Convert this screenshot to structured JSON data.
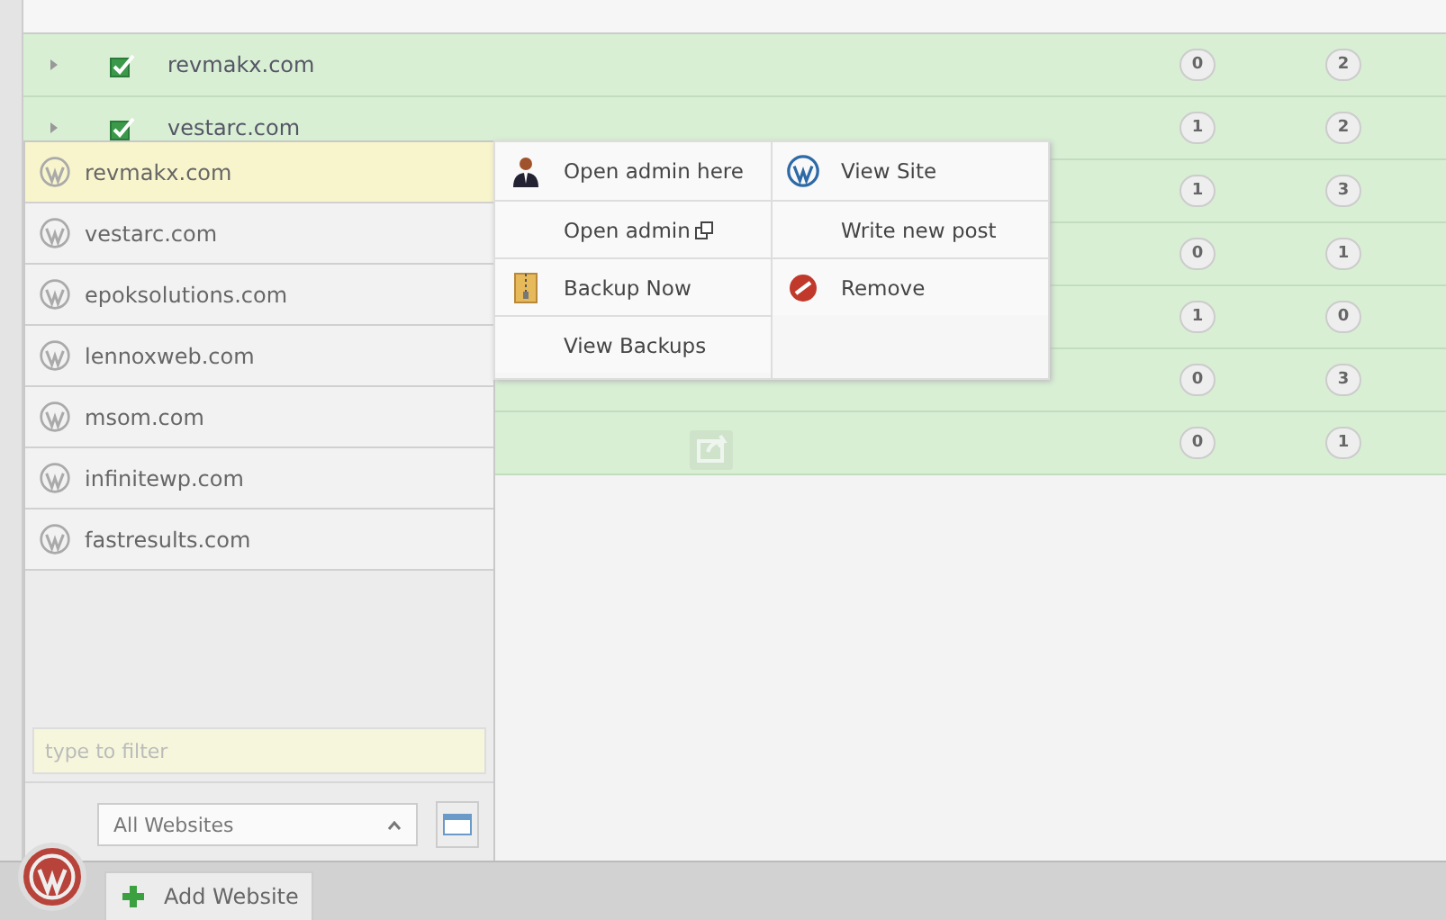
{
  "table": {
    "rows": [
      {
        "name": "revmakx.com",
        "checked": true,
        "wp": "0",
        "plugins": "2"
      },
      {
        "name": "vestarc.com",
        "checked": true,
        "wp": "1",
        "plugins": "2"
      },
      {
        "wp": "1",
        "plugins": "3"
      },
      {
        "wp": "0",
        "plugins": "1"
      },
      {
        "wp": "1",
        "plugins": "0"
      },
      {
        "wp": "0",
        "plugins": "3"
      },
      {
        "wp": "0",
        "plugins": "1"
      }
    ]
  },
  "site_panel": {
    "sites": [
      {
        "name": "revmakx.com",
        "selected": true
      },
      {
        "name": "vestarc.com",
        "selected": false
      },
      {
        "name": "epoksolutions.com",
        "selected": false
      },
      {
        "name": "lennoxweb.com",
        "selected": false
      },
      {
        "name": "msom.com",
        "selected": false
      },
      {
        "name": "infinitewp.com",
        "selected": false
      },
      {
        "name": "fastresults.com",
        "selected": false
      }
    ],
    "filter": {
      "placeholder": "type to filter"
    },
    "dropdown": {
      "value": "All Websites"
    }
  },
  "context_menu": {
    "columns": [
      [
        {
          "label": "Open admin here",
          "kind": "admin"
        },
        {
          "label": "Open admin",
          "kind": "external"
        },
        {
          "label": "Backup Now",
          "kind": "archive"
        },
        {
          "label": "View Backups",
          "kind": "plain"
        }
      ],
      [
        {
          "label": "View Site",
          "kind": "wordpress"
        },
        {
          "label": "Write new post",
          "kind": "plain"
        },
        {
          "label": "Remove",
          "kind": "remove"
        }
      ]
    ]
  },
  "bottom_bar": {
    "add_button": "Add Website"
  }
}
